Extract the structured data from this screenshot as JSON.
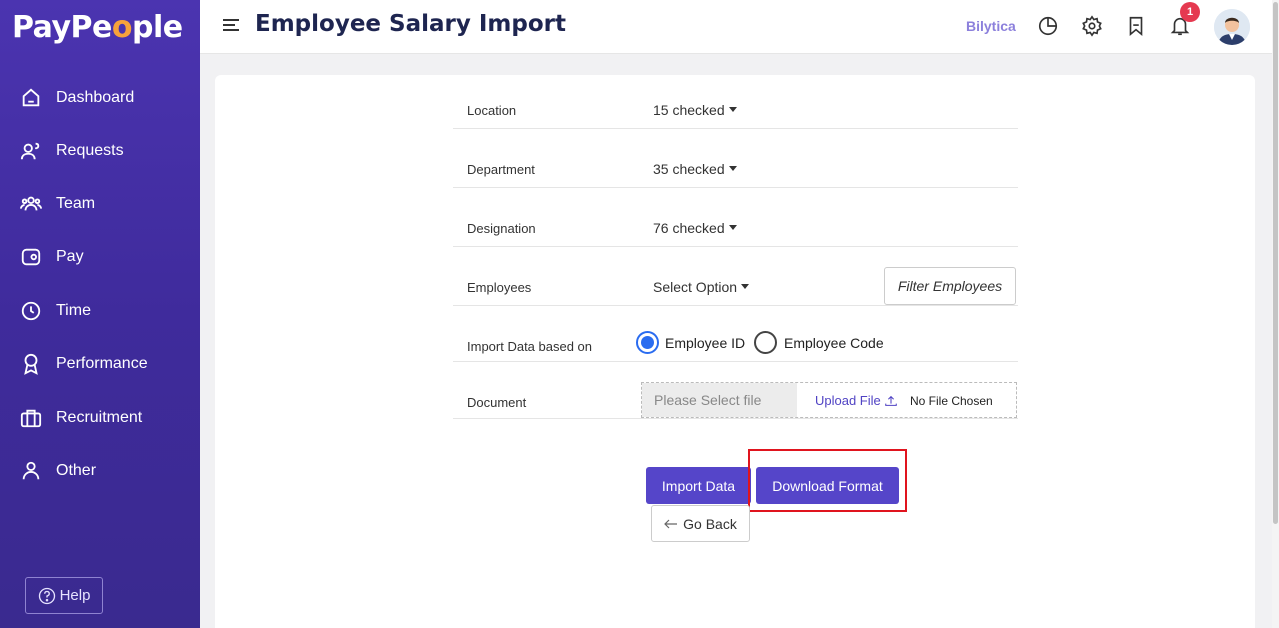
{
  "app": {
    "logo_prefix": "PayPe",
    "logo_o": "o",
    "logo_suffix": "ple"
  },
  "sidebar": {
    "items": [
      {
        "label": "Dashboard",
        "icon": "home-icon"
      },
      {
        "label": "Requests",
        "icon": "user-question-icon"
      },
      {
        "label": "Team",
        "icon": "team-icon"
      },
      {
        "label": "Pay",
        "icon": "wallet-icon"
      },
      {
        "label": "Time",
        "icon": "clock-icon"
      },
      {
        "label": "Performance",
        "icon": "award-icon"
      },
      {
        "label": "Recruitment",
        "icon": "briefcase-icon"
      },
      {
        "label": "Other",
        "icon": "person-icon"
      }
    ],
    "help_label": "Help"
  },
  "header": {
    "title": "Employee Salary Import",
    "company": "Bilytica",
    "notification_count": "1"
  },
  "form": {
    "rows": [
      {
        "label": "Location",
        "value": "15 checked"
      },
      {
        "label": "Department",
        "value": "35 checked"
      },
      {
        "label": "Designation",
        "value": "76 checked"
      },
      {
        "label": "Employees",
        "value": "Select Option"
      }
    ],
    "filter_button": "Filter Employees",
    "import_based_label": "Import Data based on",
    "radio_options": [
      {
        "label": "Employee ID",
        "checked": true
      },
      {
        "label": "Employee Code",
        "checked": false
      }
    ],
    "document_label": "Document",
    "file_placeholder": "Please Select file",
    "upload_label": "Upload File",
    "no_file_label": "No File Chosen"
  },
  "actions": {
    "import_label": "Import Data",
    "download_label": "Download Format",
    "back_label": "Go Back"
  },
  "colors": {
    "primary": "#5545c9",
    "sidebar": "#4b34b0",
    "accent": "#f7a23b",
    "highlight": "#e0141e",
    "radio": "#2a6cf0"
  }
}
